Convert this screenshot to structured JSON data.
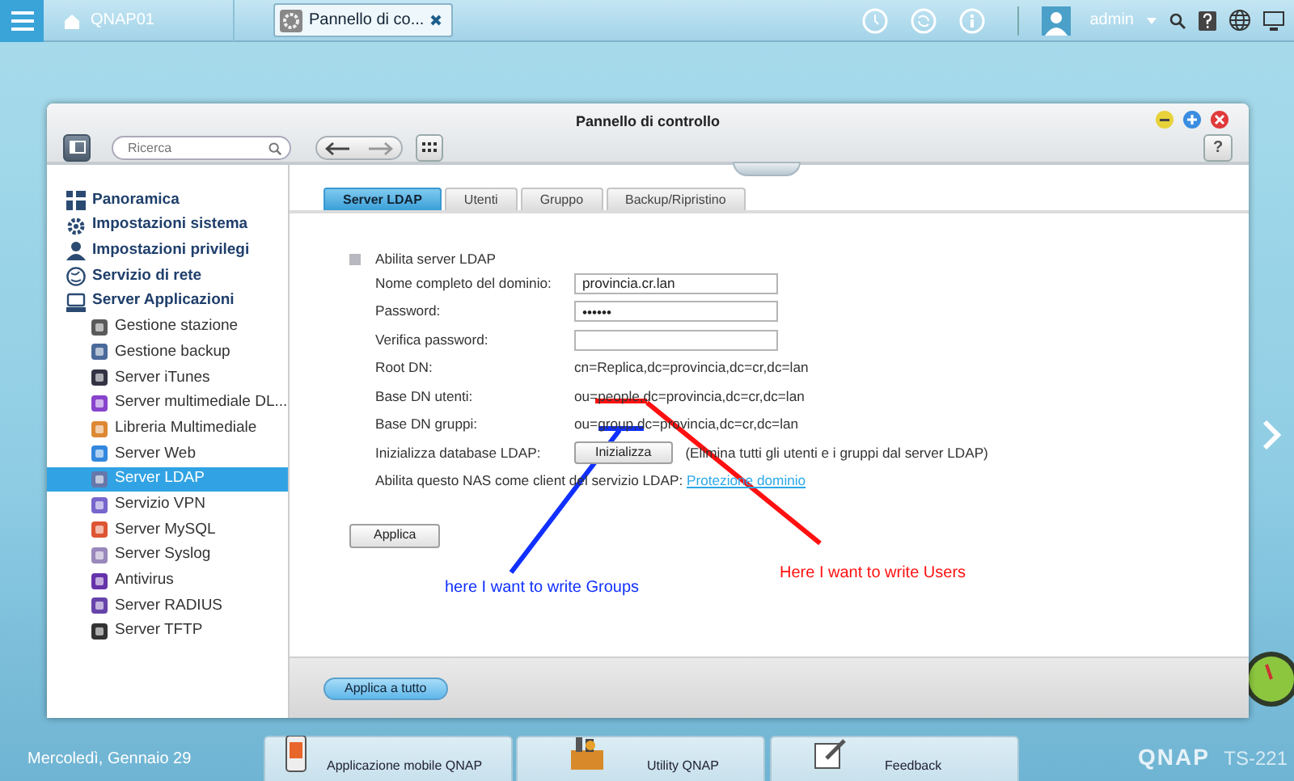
{
  "top_bar": {
    "home_label": "QNAP01",
    "open_app": {
      "label": "Pannello di co...",
      "selected": true
    },
    "user": "admin"
  },
  "window": {
    "title": "Pannello di controllo",
    "search": {
      "placeholder": "Ricerca"
    },
    "help": "?"
  },
  "sidebar": {
    "items": [
      {
        "label": "Panoramica",
        "selected": false
      },
      {
        "label": "Impostazioni sistema",
        "selected": false
      },
      {
        "label": "Impostazioni privilegi",
        "selected": false
      },
      {
        "label": "Servizio di rete",
        "selected": false
      },
      {
        "label": "Server Applicazioni",
        "selected": false,
        "children": [
          {
            "label": "Gestione stazione",
            "selected": false
          },
          {
            "label": "Gestione backup",
            "selected": false
          },
          {
            "label": "Server iTunes",
            "selected": false
          },
          {
            "label": "Server multimediale DL...",
            "selected": false
          },
          {
            "label": "Libreria Multimediale",
            "selected": false
          },
          {
            "label": "Server Web",
            "selected": false
          },
          {
            "label": "Server LDAP",
            "selected": true
          },
          {
            "label": "Servizio VPN",
            "selected": false
          },
          {
            "label": "Server MySQL",
            "selected": false
          },
          {
            "label": "Server Syslog",
            "selected": false
          },
          {
            "label": "Antivirus",
            "selected": false
          },
          {
            "label": "Server RADIUS",
            "selected": false
          },
          {
            "label": "Server TFTP",
            "selected": false
          }
        ]
      }
    ]
  },
  "tabs": [
    {
      "label": "Server LDAP",
      "selected": true
    },
    {
      "label": "Utenti",
      "selected": false
    },
    {
      "label": "Gruppo",
      "selected": false
    },
    {
      "label": "Backup/Ripristino",
      "selected": false
    }
  ],
  "form": {
    "enable": {
      "label": "Abilita server LDAP",
      "checked": false
    },
    "rows": [
      {
        "kind": "input",
        "label": "Nome completo del dominio:",
        "value": "provincia.cr.lan"
      },
      {
        "kind": "input",
        "label": "Password:",
        "value": "••••••"
      },
      {
        "kind": "input",
        "label": "Verifica password:"
      },
      {
        "kind": "text",
        "label": "Root DN:",
        "value": "cn=Replica,dc=provincia,dc=cr,dc=lan"
      },
      {
        "kind": "text",
        "label": "Base DN utenti:",
        "value": "ou=people,dc=provincia,dc=cr,dc=lan"
      },
      {
        "kind": "text",
        "label": "Base DN gruppi:",
        "value": "ou=group,dc=provincia,dc=cr,dc=lan"
      },
      {
        "kind": "button",
        "label": "Inizializza database LDAP:",
        "button": "Inizializza",
        "note": "(Elimina tutti gli utenti e i gruppi dal server LDAP)"
      }
    ],
    "client": {
      "text": "Abilita questo NAS come client del servizio LDAP:",
      "link": "Protezione dominio"
    },
    "apply": "Applica"
  },
  "footer": {
    "button": "Applica a tutto"
  },
  "annotations": [
    {
      "text": "here I want to write Groups",
      "color": "#1030ff"
    },
    {
      "text": "Here I want to write Users",
      "color": "#ff1010"
    }
  ],
  "taskbar": {
    "date": "Mercoledì, Gennaio 29",
    "apps": [
      "Applicazione mobile QNAP",
      "Utility QNAP",
      "Feedback"
    ],
    "brand": "QNAP",
    "model": "TS-221"
  }
}
